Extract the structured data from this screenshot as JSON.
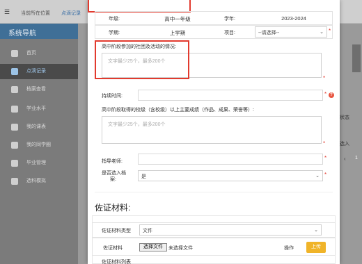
{
  "topbar": {
    "menu_icon": "menu-icon",
    "crumb_home": "当前所在位置",
    "crumb_current": "点滴记录"
  },
  "sidebar": {
    "title": "系统导航",
    "items": [
      {
        "label": "首页",
        "icon": "home-icon"
      },
      {
        "label": "点滴记录",
        "icon": "edit-icon",
        "active": true
      },
      {
        "label": "档案查看",
        "icon": "archive-icon"
      },
      {
        "label": "学业水平",
        "icon": "chart-icon"
      },
      {
        "label": "我的课表",
        "icon": "schedule-icon"
      },
      {
        "label": "我的同学圈",
        "icon": "group-icon"
      },
      {
        "label": "毕业管理",
        "icon": "user-icon"
      },
      {
        "label": "选科模拟",
        "icon": "clipboard-icon"
      }
    ]
  },
  "background_right": {
    "r1": "状态",
    "r2": "选入",
    "r3": "1"
  },
  "form": {
    "grade_label": "年级:",
    "grade_value": "高中一年级",
    "school_year_label": "学年:",
    "school_year_value": "2023-2024",
    "semester_label": "学期:",
    "semester_value": "上学期",
    "project_label": "项目:",
    "project_value": "--请选择--",
    "clubs_label": "高中阶段参加的社团及活动的情况:",
    "clubs_placeholder": "文字最少25个，最多200个",
    "duration_label": "持续时间:",
    "achievements_label": "高中阶段取得的校级（含校级）以上主要成绩（作品、成果、荣誉等）:",
    "achievements_placeholder": "文字最少25个，最多200个",
    "mentor_label": "指导老师:",
    "archive_label_line1": "是否选入档",
    "archive_label_line2": "案:",
    "archive_value": "是",
    "required_mark": "*",
    "help_mark": "?"
  },
  "evidence": {
    "title": "佐证材料:",
    "type_label": "佐证材料类型",
    "type_value": "文件",
    "file_label": "佐证材料",
    "choose_file": "选择文件",
    "no_file": "未选择文件",
    "op_label": "操作",
    "upload": "上传",
    "list_label": "佐证材料列表"
  }
}
